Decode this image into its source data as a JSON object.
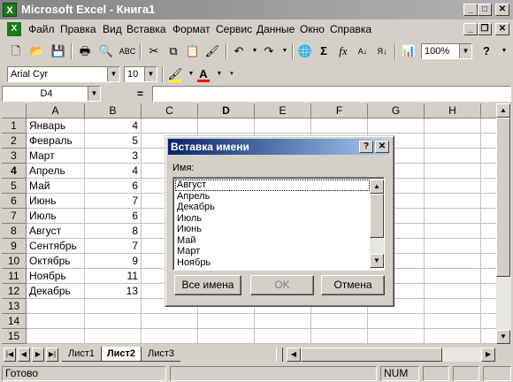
{
  "window": {
    "title": "Microsoft Excel - Книга1",
    "icon": "excel-icon"
  },
  "menu": {
    "items": [
      "Файл",
      "Правка",
      "Вид",
      "Вставка",
      "Формат",
      "Сервис",
      "Данные",
      "Окно",
      "Справка"
    ]
  },
  "toolbar": {
    "zoom": "100%",
    "font_name": "Arial Cyr",
    "font_size": "10"
  },
  "formula_bar": {
    "name_box": "D4",
    "equals": "=",
    "value": ""
  },
  "sheet": {
    "columns": [
      "A",
      "B",
      "C",
      "D",
      "E",
      "F",
      "G",
      "H"
    ],
    "rows": [
      "1",
      "2",
      "3",
      "4",
      "5",
      "6",
      "7",
      "8",
      "9",
      "10",
      "11",
      "12",
      "13",
      "14",
      "15"
    ],
    "month_cells": [
      "Январь",
      "Февраль",
      "Март",
      "Апрель",
      "Май",
      "Июнь",
      "Июль",
      "Август",
      "Сентябрь",
      "Октябрь",
      "Ноябрь",
      "Декабрь"
    ],
    "value_cells": [
      "4",
      "5",
      "3",
      "4",
      "6",
      "7",
      "6",
      "8",
      "7",
      "9",
      "11",
      "13"
    ],
    "active_cell": "D4"
  },
  "tabs": {
    "sheets": [
      "Лист1",
      "Лист2",
      "Лист3"
    ],
    "active": "Лист2"
  },
  "status": {
    "ready": "Готово",
    "num": "NUM"
  },
  "dialog": {
    "title": "Вставка имени",
    "help_glyph": "?",
    "close_glyph": "✕",
    "list_label": "Имя:",
    "names": [
      "Август",
      "Апрель",
      "Декабрь",
      "Июль",
      "Июнь",
      "Май",
      "Март",
      "Ноябрь"
    ],
    "selected": "Август",
    "btn_all_names": "Все имена",
    "btn_ok": "OK",
    "btn_cancel": "Отмена"
  },
  "colors": {
    "titlebar": "#848284",
    "dialog_title": "#0a246a",
    "selection": "#d4d0c8"
  }
}
